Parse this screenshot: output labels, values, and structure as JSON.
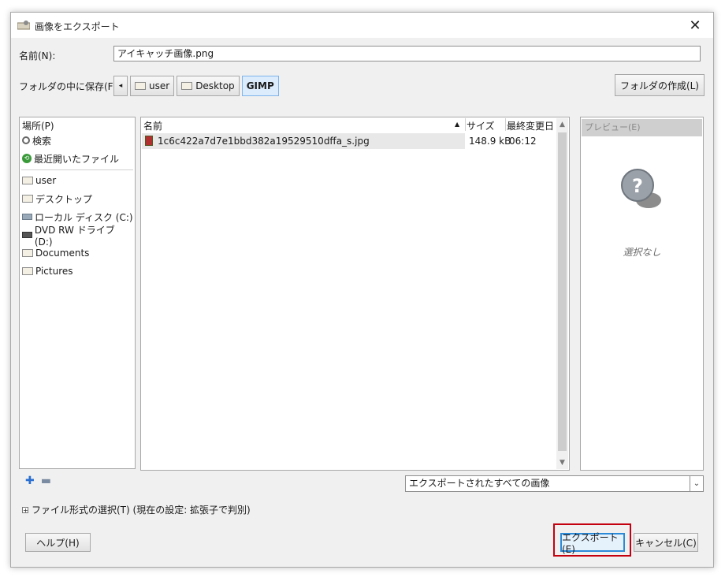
{
  "window": {
    "title": "画像をエクスポート",
    "close_glyph": "✕"
  },
  "name": {
    "label": "名前(N):",
    "value": "アイキャッチ画像.png"
  },
  "save_in": {
    "label": "フォルダの中に保存(F):",
    "back_glyph": "◂",
    "path": [
      "user",
      "Desktop",
      "GIMP"
    ],
    "create_folder_label": "フォルダの作成(L)"
  },
  "places": {
    "header": "場所(P)",
    "items": [
      {
        "label": "検索",
        "icon": "search-icon"
      },
      {
        "label": "最近開いたファイル",
        "icon": "recent-icon"
      },
      {
        "label": "user",
        "icon": "folder-icon"
      },
      {
        "label": "デスクトップ",
        "icon": "folder-icon"
      },
      {
        "label": "ローカル ディスク (C:)",
        "icon": "drive-icon"
      },
      {
        "label": "DVD RW ドライブ (D:)",
        "icon": "dvd-drive-icon"
      },
      {
        "label": "Documents",
        "icon": "folder-icon"
      },
      {
        "label": "Pictures",
        "icon": "folder-icon"
      }
    ],
    "add_glyph": "✚",
    "remove_glyph": "▬"
  },
  "files": {
    "columns": {
      "name": "名前",
      "size": "サイズ",
      "modified": "最終変更日"
    },
    "sort_glyph": "▲",
    "rows": [
      {
        "name": "1c6c422a7d7e1bbd382a19529510dffa_s.jpg",
        "size": "148.9 kB",
        "modified": "06:12"
      }
    ],
    "scroll_up": "▲",
    "scroll_down": "▼"
  },
  "preview": {
    "header": "プレビュー(E)",
    "empty_text": "選択なし"
  },
  "filter": {
    "selected": "エクスポートされたすべての画像",
    "chevron": "⌄"
  },
  "file_type": {
    "expander": "+",
    "label": "ファイル形式の選択(T) (現在の設定: 拡張子で判別)"
  },
  "buttons": {
    "help": "ヘルプ(H)",
    "export": "エクスポート(E)",
    "cancel": "キャンセル(C)"
  },
  "colors": {
    "highlight": "#c4000f",
    "primary_border": "#2b8ad8",
    "accent_blue": "#2a6fd1"
  }
}
